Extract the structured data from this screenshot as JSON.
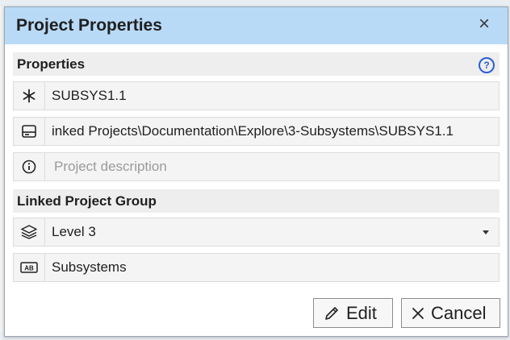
{
  "dialog": {
    "title": "Project Properties",
    "close_glyph": "×"
  },
  "properties": {
    "header": "Properties",
    "help_glyph": "?",
    "name_value": "SUBSYS1.1",
    "path_value": "inked Projects\\Documentation\\Explore\\3-Subsystems\\SUBSYS1.1",
    "description_placeholder": "Project description"
  },
  "linked_group": {
    "header": "Linked Project Group",
    "level_value": "Level 3",
    "group_value": "Subsystems"
  },
  "buttons": {
    "edit_label": "Edit",
    "cancel_label": "Cancel"
  },
  "icons": {
    "name": "asterisk-icon",
    "path": "drive-icon",
    "description": "info-icon",
    "level": "layers-icon",
    "group": "text-label-icon",
    "edit": "pencil-icon",
    "cancel": "x-icon"
  },
  "colors": {
    "titlebar": "#b8daf7",
    "help_accent": "#2b5ed8",
    "section_bg": "#eeeeee"
  }
}
